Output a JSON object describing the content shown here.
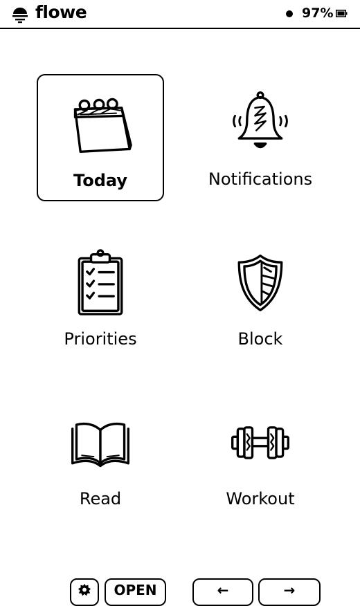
{
  "status_bar": {
    "app_name": "flowe",
    "battery": "97%"
  },
  "menu": {
    "items": [
      {
        "label": "Today",
        "icon": "calendar-icon",
        "selected": true
      },
      {
        "label": "Notifications",
        "icon": "bell-icon",
        "selected": false
      },
      {
        "label": "Priorities",
        "icon": "clipboard-checklist-icon",
        "selected": false
      },
      {
        "label": "Block",
        "icon": "shield-icon",
        "selected": false
      },
      {
        "label": "Read",
        "icon": "book-icon",
        "selected": false
      },
      {
        "label": "Workout",
        "icon": "dumbbell-icon",
        "selected": false
      }
    ]
  },
  "bottom_bar": {
    "settings_icon": "gear-icon",
    "open_label": "OPEN",
    "prev_label": "←",
    "next_label": "→"
  }
}
